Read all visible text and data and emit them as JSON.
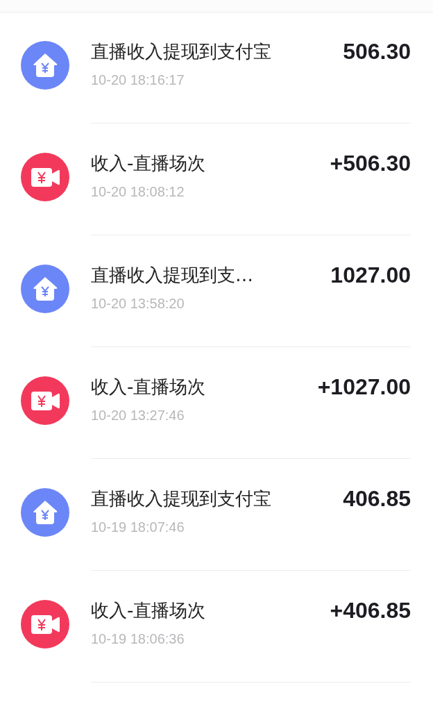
{
  "transactions": [
    {
      "kind": "withdraw",
      "title": "直播收入提现到支付宝",
      "time": "10-20 18:16:17",
      "amount": "506.30"
    },
    {
      "kind": "income",
      "title": "收入-直播场次",
      "time": "10-20 18:08:12",
      "amount": "+506.30"
    },
    {
      "kind": "withdraw",
      "title": "直播收入提现到支…",
      "time": "10-20 13:58:20",
      "amount": "1027.00"
    },
    {
      "kind": "income",
      "title": "收入-直播场次",
      "time": "10-20 13:27:46",
      "amount": "+1027.00"
    },
    {
      "kind": "withdraw",
      "title": "直播收入提现到支付宝",
      "time": "10-19 18:07:46",
      "amount": "406.85"
    },
    {
      "kind": "income",
      "title": "收入-直播场次",
      "time": "10-19 18:06:36",
      "amount": "+406.85"
    }
  ]
}
